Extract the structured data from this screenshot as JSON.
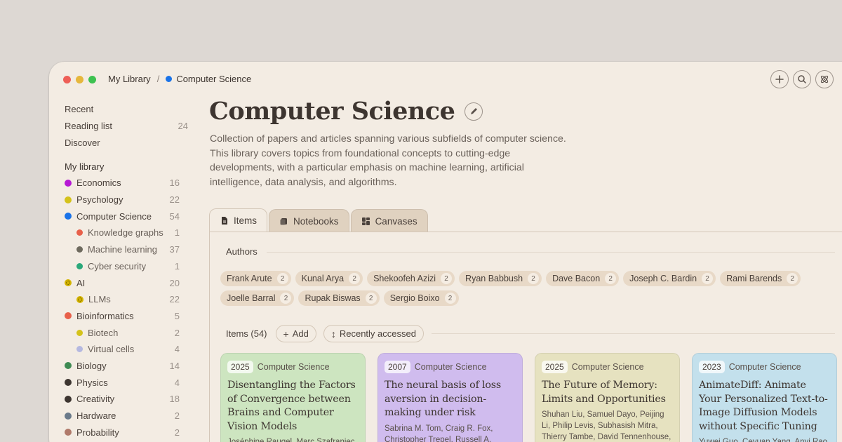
{
  "breadcrumb": {
    "root": "My Library",
    "separator": "/",
    "current": "Computer Science",
    "current_color": "#1a73e8"
  },
  "toolbar": {
    "icons": [
      "plus-icon",
      "search-icon",
      "atom-icon"
    ]
  },
  "sidebar": {
    "top": [
      {
        "label": "Recent",
        "count": ""
      },
      {
        "label": "Reading list",
        "count": "24"
      },
      {
        "label": "Discover",
        "count": ""
      }
    ],
    "heading": "My library",
    "items": [
      {
        "label": "Economics",
        "count": "16",
        "color": "#b619d4",
        "sub": false
      },
      {
        "label": "Psychology",
        "count": "22",
        "color": "#d4c21a",
        "sub": false
      },
      {
        "label": "Computer Science",
        "count": "54",
        "color": "#1a73e8",
        "sub": false
      },
      {
        "label": "Knowledge graphs",
        "count": "1",
        "color": "#e8604a",
        "sub": true
      },
      {
        "label": "Machine learning",
        "count": "37",
        "color": "#6e6a5e",
        "sub": true
      },
      {
        "label": "Cyber security",
        "count": "1",
        "color": "#2aa87a",
        "sub": true
      },
      {
        "label": "AI",
        "count": "20",
        "color": "#d4b400",
        "sub": false
      },
      {
        "label": "LLMs",
        "count": "22",
        "color": "#d4b400",
        "sub": true
      },
      {
        "label": "Bioinformatics",
        "count": "5",
        "color": "#e8604a",
        "sub": false
      },
      {
        "label": "Biotech",
        "count": "2",
        "color": "#d4c21a",
        "sub": true
      },
      {
        "label": "Virtual cells",
        "count": "4",
        "color": "#b5b8e0",
        "sub": true
      },
      {
        "label": "Biology",
        "count": "14",
        "color": "#3e8a52",
        "sub": false
      },
      {
        "label": "Physics",
        "count": "4",
        "color": "#3d3530",
        "sub": false
      },
      {
        "label": "Creativity",
        "count": "18",
        "color": "#3d3530",
        "sub": false
      },
      {
        "label": "Hardware",
        "count": "2",
        "color": "#6a7a8a",
        "sub": false
      },
      {
        "label": "Probability",
        "count": "2",
        "color": "#b07a6a",
        "sub": false
      }
    ]
  },
  "main": {
    "title": "Computer Science",
    "description": "Collection of papers and articles spanning various subfields of computer science. This library covers topics from foundational concepts to cutting-edge developments, with a particular emphasis on machine learning, artificial intelligence, data analysis, and algorithms.",
    "tabs": [
      {
        "label": "Items",
        "active": true
      },
      {
        "label": "Notebooks",
        "active": false
      },
      {
        "label": "Canvases",
        "active": false
      }
    ],
    "authors_label": "Authors",
    "authors": [
      {
        "name": "Frank Arute",
        "count": "2"
      },
      {
        "name": "Kunal Arya",
        "count": "2"
      },
      {
        "name": "Shekoofeh Azizi",
        "count": "2"
      },
      {
        "name": "Ryan Babbush",
        "count": "2"
      },
      {
        "name": "Dave Bacon",
        "count": "2"
      },
      {
        "name": "Joseph C. Bardin",
        "count": "2"
      },
      {
        "name": "Rami Barends",
        "count": "2"
      },
      {
        "name": "Joelle Barral",
        "count": "2"
      },
      {
        "name": "Rupak Biswas",
        "count": "2"
      },
      {
        "name": "Sergio Boixo",
        "count": "2"
      }
    ],
    "items_label": "Items (54)",
    "add_label": "Add",
    "sort_label": "Recently accessed",
    "cards": [
      {
        "year": "2025",
        "category": "Computer Science",
        "title": "Disentangling the Factors of Convergence between Brains and Computer Vision Models",
        "authors": "Joséphine Raugel, Marc Szafraniec",
        "color": "#cde5c0"
      },
      {
        "year": "2007",
        "category": "Computer Science",
        "title": "The neural basis of loss aversion in decision-making under risk",
        "authors": "Sabrina M. Tom, Craig R. Fox, Christopher Trepel, Russell A. Poldrack",
        "color": "#d0bcee"
      },
      {
        "year": "2025",
        "category": "Computer Science",
        "title": "The Future of Memory: Limits and Opportunities",
        "authors": "Shuhan Liu, Samuel Dayo, Peijing Li, Philip Levis, Subhasish Mitra, Thierry Tambe, David Tennenhouse, H.-S. Philip Wong",
        "color": "#e6e2c0"
      },
      {
        "year": "2023",
        "category": "Computer Science",
        "title": "AnimateDiff: Animate Your Personalized Text-to-Image Diffusion Models without Specific Tuning",
        "authors": "Yuwei Guo, Ceyuan Yang, Anyi Rao",
        "color": "#c3e0ec"
      }
    ]
  }
}
